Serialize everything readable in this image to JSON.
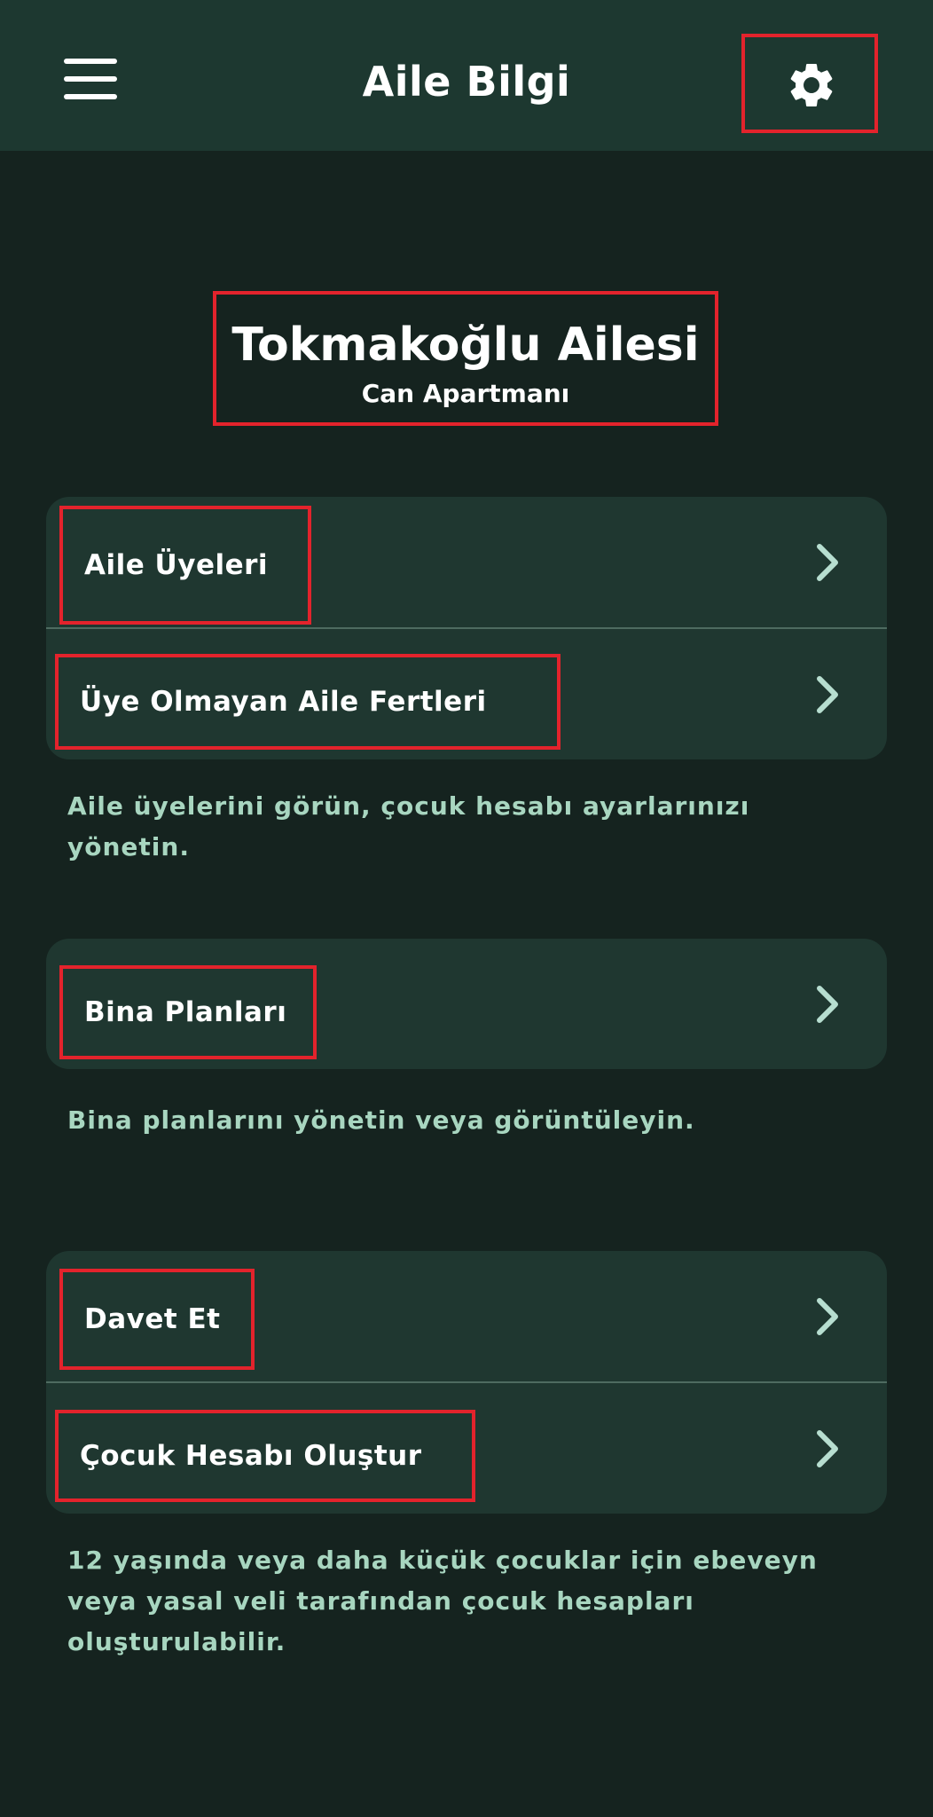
{
  "header": {
    "title": "Aile Bilgi",
    "menu_icon": "hamburger-menu-icon",
    "settings_icon": "gear-icon"
  },
  "family": {
    "name": "Tokmakoğlu Ailesi",
    "address": "Can Apartmanı"
  },
  "sections": [
    {
      "items": [
        {
          "label": "Aile Üyeleri"
        },
        {
          "label": "Üye Olmayan Aile Fertleri"
        }
      ],
      "note": "Aile üyelerini görün, çocuk hesabı ayarlarınızı yönetin."
    },
    {
      "items": [
        {
          "label": "Bina Planları"
        }
      ],
      "note": "Bina planlarını yönetin veya görüntüleyin."
    },
    {
      "items": [
        {
          "label": "Davet Et"
        },
        {
          "label": "Çocuk Hesabı Oluştur"
        }
      ],
      "note": "12 yaşında veya daha küçük çocuklar için ebeveyn veya yasal veli tarafından çocuk hesapları oluşturulabilir."
    }
  ],
  "colors": {
    "background": "#15231f",
    "header": "#1d3830",
    "card": "#1f3730",
    "note_text": "#a8d6c0",
    "chevron": "#b7ded0",
    "highlight": "#e3232c"
  }
}
